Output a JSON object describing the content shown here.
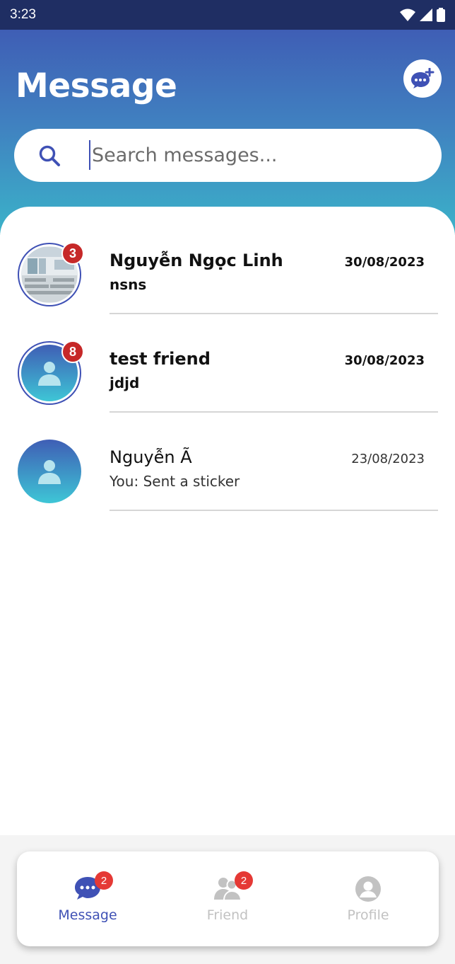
{
  "status_bar": {
    "time": "3:23"
  },
  "header": {
    "title": "Message",
    "search": {
      "placeholder": "Search messages...",
      "value": ""
    }
  },
  "conversations": [
    {
      "name": "Nguyễn Ngọc Linh",
      "preview": "nsns",
      "date": "30/08/2023",
      "unread": "3",
      "avatar": "photo"
    },
    {
      "name": "test friend",
      "preview": "jdjd",
      "date": "30/08/2023",
      "unread": "8",
      "avatar": "default-user"
    },
    {
      "name": "Nguyễn Ã",
      "preview": "You: Sent a sticker",
      "date": "23/08/2023",
      "unread": "",
      "avatar": "default-user"
    }
  ],
  "bottom_nav": {
    "items": [
      {
        "label": "Message",
        "badge": "2",
        "icon": "message-icon",
        "active": true
      },
      {
        "label": "Friend",
        "badge": "2",
        "icon": "friends-icon",
        "active": false
      },
      {
        "label": "Profile",
        "badge": "",
        "icon": "profile-icon",
        "active": false
      }
    ]
  },
  "colors": {
    "accent": "#3f51b5",
    "badge": "#c62828",
    "header_gradient_top": "#3f5eb5",
    "header_gradient_bottom": "#3bb3c9",
    "nav_inactive": "#c2c2c2"
  }
}
